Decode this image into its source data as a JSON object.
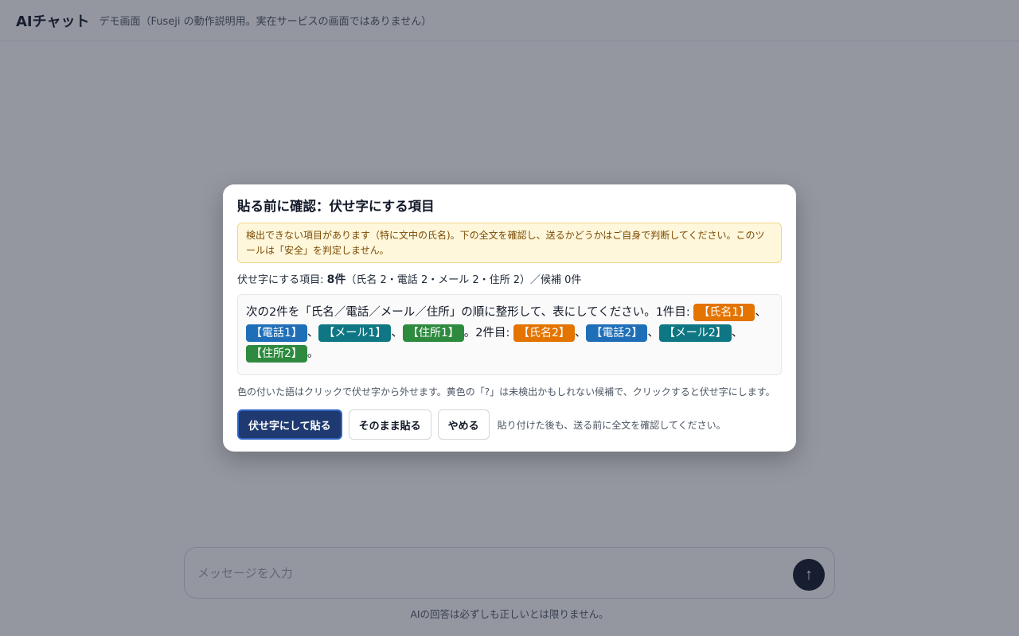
{
  "app": {
    "title": "AIチャット",
    "subtitle": "デモ画面（Fuseji の動作説明用。実在サービスの画面ではありません）",
    "composer_placeholder": "メッセージを入力",
    "send_icon": "↑",
    "disclaimer": "AIの回答は必ずしも正しいとは限りません。"
  },
  "modal": {
    "title": "貼る前に確認：伏せ字にする項目",
    "warning": "検出できない項目があります（特に文中の氏名)。下の全文を確認し、送るかどうかはご自身で判断してください。このツールは「安全」を判定しません。",
    "summary": {
      "label": "伏せ字にする項目: ",
      "count": "8件",
      "detail": "（氏名 2・電話 2・メール 2・住所 2）／候補 0件"
    },
    "preview": {
      "t0": "次の2件を「氏名／電話／メール／住所」の順に整形して、表にしてください。1件目: ",
      "name1": "【氏名1】",
      "sep1": "、",
      "phone1": "【電話1】",
      "sep2": "、",
      "mail1": "【メール1】",
      "sep3": "、",
      "addr1": "【住所1】",
      "t1": "。2件目: ",
      "name2": "【氏名2】",
      "sep4": "、",
      "phone2": "【電話2】",
      "sep5": "、",
      "mail2": "【メール2】",
      "sep6": "、",
      "addr2": "【住所2】",
      "t2": "。"
    },
    "hint": "色の付いた語はクリックで伏せ字から外せます。黄色の「?」は未検出かもしれない候補で、クリックすると伏せ字にします。",
    "buttons": {
      "masked_paste": "伏せ字にして貼る",
      "plain_paste": "そのまま貼る",
      "cancel": "やめる"
    },
    "after_note": "貼り付けた後も、送る前に全文を確認してください。"
  },
  "colors": {
    "name_chip": "#e37400",
    "phone_chip": "#1f6fb8",
    "mail_chip": "#0f7783",
    "address_chip": "#2d8a3e",
    "primary_button": "#1f3a70"
  }
}
